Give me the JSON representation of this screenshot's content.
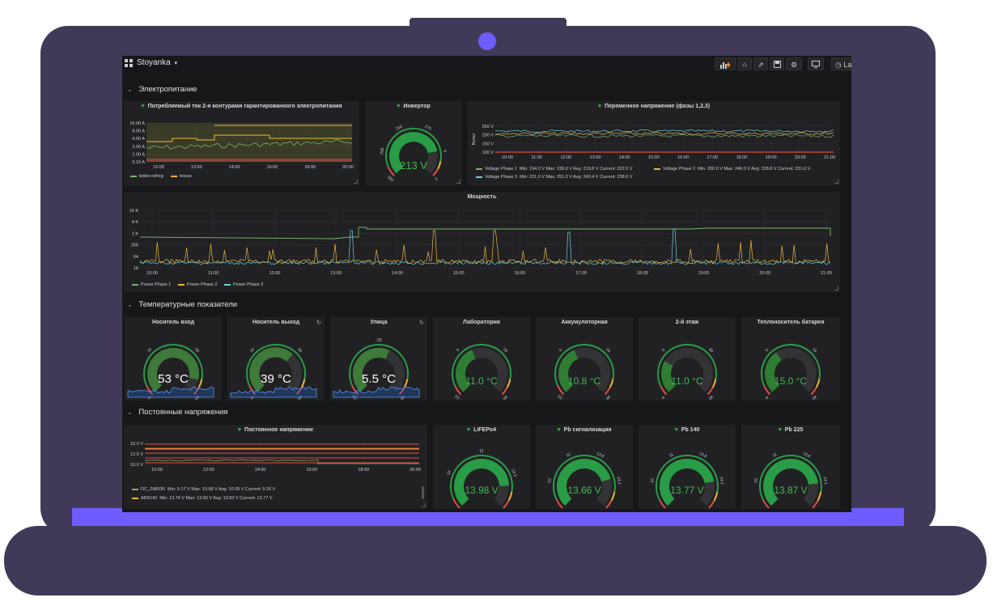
{
  "dashboard": {
    "title": "Stoyanka",
    "title_caret": "▾",
    "toolbar": {
      "add_panel_icon": "add-panel-icon",
      "star_icon": "star-icon",
      "share_icon": "share-icon",
      "save_icon": "save-icon",
      "settings_icon": "gear-icon",
      "tv_icon": "monitor-icon",
      "time_picker_label": "Las"
    }
  },
  "rows": [
    {
      "title": "Электропитание"
    },
    {
      "title": "Температурные показатели"
    },
    {
      "title": "Постоянные напряжения"
    }
  ],
  "panels": {
    "current": {
      "title": "Потребляемый ток 2-я контурами гарантированного электропитания",
      "chart_data": {
        "type": "line",
        "y_ticks": [
          "16.00 A",
          "8.00 A",
          "4.00 A",
          "2.00 A",
          "1.00 A",
          "0.10 A"
        ],
        "x_ticks": [
          "10:00",
          "12:00",
          "14:00",
          "16:00",
          "18:00",
          "20:00"
        ],
        "series": [
          {
            "name": "boiler-refreg",
            "color": "#7eb26d"
          },
          {
            "name": "house",
            "color": "#eab839"
          }
        ]
      }
    },
    "inverter": {
      "title": "Инвертор",
      "value": "213 V",
      "gauge": {
        "min": 0,
        "max": 270,
        "value": 213,
        "ticks": [
          "180",
          "200",
          "210",
          "270",
          "0",
          "0"
        ]
      }
    },
    "ac_voltage": {
      "title": "Переменное напряжение (фазы 1,2,3)",
      "chart_data": {
        "type": "line",
        "ylabel": "Вольт",
        "y_ticks": [
          "250 V",
          "200 V",
          "150 V",
          "100 V"
        ],
        "x_ticks": [
          "10:00",
          "11:00",
          "12:00",
          "13:00",
          "14:00",
          "15:00",
          "16:00",
          "17:00",
          "18:00",
          "19:00",
          "20:00",
          "21:00"
        ],
        "series": [
          {
            "name": "Voltage Phase 1",
            "stats": "Min: 194.0 V  Max: 236.0 V  Avg: 219.8 V  Current: 222.0 V",
            "color": "#7eb26d"
          },
          {
            "name": "Voltage Phase 2",
            "stats": "Min: 200.0 V  Max: 246.0 V  Avg: 228.8 V  Current: 231.0 V",
            "color": "#eab839"
          },
          {
            "name": "Voltage Phase 3",
            "stats": "Min: 221.0 V  Max: 251.0 V  Avg: 240.4 V  Current: 238.0 V",
            "color": "#6ed0e0"
          }
        ]
      }
    },
    "power": {
      "title": "Мощность",
      "chart_data": {
        "type": "line",
        "y_ticks": [
          "16 K",
          "4 K",
          "1 K",
          "256",
          "64",
          "16"
        ],
        "x_ticks": [
          "10:00",
          "11:00",
          "12:00",
          "13:00",
          "14:00",
          "15:00",
          "16:00",
          "17:00",
          "18:00",
          "19:00",
          "20:00",
          "21:00"
        ],
        "series": [
          {
            "name": "Power Phase 1",
            "color": "#7eb26d"
          },
          {
            "name": "Power Phase 2",
            "color": "#eab839"
          },
          {
            "name": "Power Phase 3",
            "color": "#6ed0e0"
          }
        ]
      }
    },
    "temps": [
      {
        "title": "Носитель вход",
        "value": "53 °C",
        "min": 0,
        "max": 60,
        "v": 53,
        "ticks": [
          "0",
          "10",
          "20",
          "60"
        ],
        "refresh_icon": false,
        "spark": true,
        "color": "#ffffff",
        "size": "big"
      },
      {
        "title": "Носитель выход",
        "value": "39 °C",
        "min": 0,
        "max": 60,
        "v": 39,
        "ticks": [
          "0",
          "10",
          "20",
          "60"
        ],
        "refresh_icon": true,
        "spark": true,
        "color": "#ffffff",
        "size": "big"
      },
      {
        "title": "Улица",
        "value": "5.5 °C",
        "min": -30,
        "max": 30,
        "v": 5.5,
        "ticks": [
          "-30",
          "-20",
          "30"
        ],
        "refresh_icon": true,
        "spark": true,
        "color": "#ffffff",
        "size": "big"
      },
      {
        "title": "Лаборатория",
        "value": "11.0 °C",
        "min": -10,
        "max": 40,
        "v": 11,
        "ticks": [
          "-10",
          "0",
          "10",
          "40"
        ],
        "refresh_icon": false,
        "spark": false,
        "color": "#3fb950",
        "size": "small"
      },
      {
        "title": "Аккумуляторная",
        "value": "10.8 °C",
        "min": -10,
        "max": 40,
        "v": 10.8,
        "ticks": [
          "-10",
          "0",
          "10",
          "40"
        ],
        "refresh_icon": false,
        "spark": false,
        "color": "#3fb950",
        "size": "small"
      },
      {
        "title": "2-й этаж",
        "value": "11.0 °C",
        "min": 0,
        "max": 40,
        "v": 11,
        "ticks": [
          "0",
          "5",
          "30",
          "40"
        ],
        "refresh_icon": false,
        "spark": false,
        "color": "#3fb950",
        "size": "small"
      },
      {
        "title": "Теплоноситель батарея",
        "value": "15.0 °C",
        "min": 0,
        "max": 40,
        "v": 15,
        "ticks": [
          "0",
          "5",
          "10",
          "40"
        ],
        "refresh_icon": false,
        "spark": false,
        "color": "#3fb950",
        "size": "small"
      }
    ],
    "dc_voltage": {
      "title": "Постоянное напряжение",
      "chart_data": {
        "type": "line",
        "y_ticks": [
          "15.0 V",
          "12.5 V",
          "10.0 V"
        ],
        "x_ticks": [
          "10:00",
          "12:00",
          "14:00",
          "16:00",
          "18:00",
          "20:00"
        ],
        "series": [
          {
            "name": "DC_ZABOR",
            "stats": "Min: 9.17 V  Max: 10.68 V  Avg: 10.09 V  Current: 9.26 V",
            "color": "#7eb26d"
          },
          {
            "name": "AKБ140",
            "stats": "Min: 13.74 V  Max: 13.90 V  Avg: 13.83 V  Current: 13.77 V",
            "color": "#eab839"
          }
        ]
      }
    },
    "batteries": [
      {
        "title": "LiFEPo4",
        "value": "13.98 V",
        "min": 9,
        "max": 15,
        "v": 13.98,
        "ticks": [
          "9",
          "10",
          "11",
          "14.2",
          "15"
        ]
      },
      {
        "title": "Pb сигнализация",
        "value": "13.66 V",
        "min": 9,
        "max": 15,
        "v": 13.66,
        "ticks": [
          "9",
          "10",
          "11",
          "13.8",
          "14.1",
          "15"
        ]
      },
      {
        "title": "Pb 140",
        "value": "13.77 V",
        "min": 9,
        "max": 15,
        "v": 13.77,
        "ticks": [
          "9",
          "10",
          "11",
          "13.8",
          "14.1",
          "15"
        ]
      },
      {
        "title": "Pb 225",
        "value": "13.87 V",
        "min": 9,
        "max": 15,
        "v": 13.87,
        "ticks": [
          "9",
          "10",
          "11",
          "13.8",
          "14.1",
          "15"
        ]
      }
    ]
  }
}
